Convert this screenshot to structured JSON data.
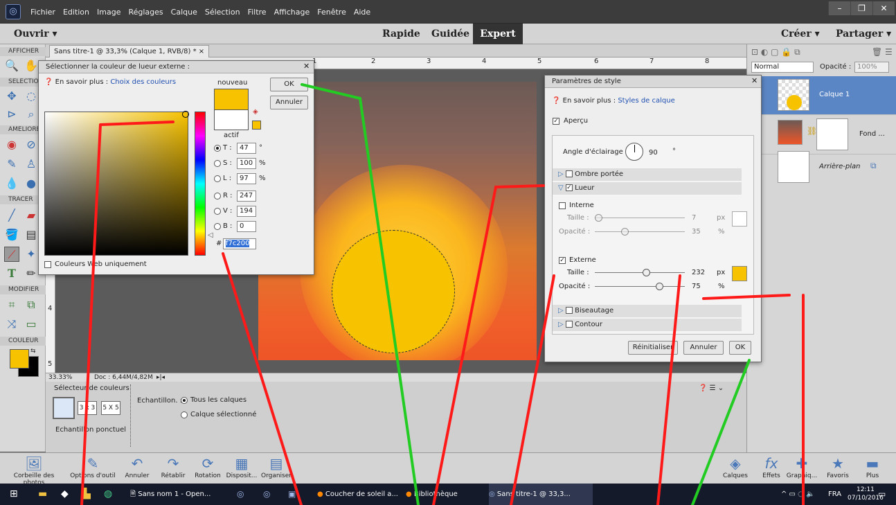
{
  "app": {
    "menu": [
      "Fichier",
      "Edition",
      "Image",
      "Réglages",
      "Calque",
      "Sélection",
      "Filtre",
      "Affichage",
      "Fenêtre",
      "Aide"
    ],
    "open_label": "Ouvrir",
    "modes": {
      "quick": "Rapide",
      "guided": "Guidée",
      "expert": "Expert"
    },
    "create_label": "Créer",
    "share_label": "Partager"
  },
  "tools": {
    "sections": {
      "view": "AFFICHER",
      "select": "SELECTIO",
      "enhance": "AMELIORE",
      "draw": "TRACER",
      "modify": "MODIFIER",
      "color": "COULEUR"
    }
  },
  "document": {
    "tab_label": "Sans titre-1 @ 33,3% (Calque 1, RVB/8) *",
    "zoom": "33.33%",
    "doc_info": "Doc : 6,44M/4,82M",
    "ruler_marks": [
      "1",
      "2",
      "3",
      "4",
      "5",
      "6",
      "7",
      "8"
    ],
    "vruler_marks": [
      "4",
      "5"
    ]
  },
  "tool_options": {
    "title": "Sélecteur de couleurs",
    "sample_sizes": [
      "3 x 3",
      "5 X 5"
    ],
    "sample_label": "Echantillon ponctuel",
    "sample_scope_label": "Echantillon. :",
    "scope_options": [
      "Tous les calques",
      "Calque sélectionné"
    ]
  },
  "layers_panel": {
    "blend_mode": "Normal",
    "opacity_label": "Opacité :",
    "opacity_value": "100%",
    "layers": [
      {
        "name": "Calque 1"
      },
      {
        "name": "Fond ..."
      },
      {
        "name": "Arrière-plan"
      }
    ]
  },
  "bottom_bar": {
    "left": [
      "Corbeille des photos",
      "Options d'outil",
      "Annuler",
      "Rétablir",
      "Rotation",
      "Disposit...",
      "Organiser"
    ],
    "right": [
      "Calques",
      "Effets",
      "Graphiq...",
      "Favoris",
      "Plus"
    ]
  },
  "color_picker": {
    "title": "Sélectionner la couleur de lueur externe :",
    "help_prefix": "En savoir plus :",
    "help_link": "Choix des couleurs",
    "new_label": "nouveau",
    "current_label": "actif",
    "ok": "OK",
    "cancel": "Annuler",
    "fields": [
      {
        "label": "T :",
        "value": "47",
        "unit": "°"
      },
      {
        "label": "S :",
        "value": "100",
        "unit": "%"
      },
      {
        "label": "L :",
        "value": "97",
        "unit": "%"
      },
      {
        "label": "R :",
        "value": "247",
        "unit": ""
      },
      {
        "label": "V :",
        "value": "194",
        "unit": ""
      },
      {
        "label": "B :",
        "value": "0",
        "unit": ""
      }
    ],
    "hash": "#",
    "hex": "f7c200",
    "web_only": "Couleurs Web uniquement",
    "new_color": "#f7c200"
  },
  "style_dialog": {
    "title": "Paramètres de style",
    "help_prefix": "En savoir plus :",
    "help_link": "Styles de calque",
    "preview": "Aperçu",
    "angle_label": "Angle d'éclairage :",
    "angle_value": "90",
    "angle_unit": "°",
    "sections": {
      "drop_shadow": "Ombre portée",
      "glow": "Lueur",
      "bevel": "Biseautage",
      "stroke": "Contour"
    },
    "inner": {
      "label": "Interne",
      "size_label": "Taille :",
      "size_value": "7",
      "size_unit": "px",
      "opacity_label": "Opacité :",
      "opacity_value": "35",
      "opacity_unit": "%"
    },
    "outer": {
      "label": "Externe",
      "size_label": "Taille :",
      "size_value": "232",
      "size_unit": "px",
      "opacity_label": "Opacité :",
      "opacity_value": "75",
      "opacity_unit": "%",
      "color": "#f7c200"
    },
    "reset": "Réinitialiser",
    "cancel": "Annuler",
    "ok": "OK"
  },
  "taskbar": {
    "items": [
      "Sans nom 1 - Open...",
      "Coucher de soleil a...",
      "Bibliothèque",
      "Sans titre-1 @ 33,3..."
    ],
    "lang": "FRA",
    "time": "12:11",
    "date": "07/10/2016"
  },
  "colors": {
    "accent": "#f7c200",
    "selected_layer": "#5b86c5",
    "annotation_red": "#ff1a1a",
    "annotation_green": "#22cc22"
  }
}
